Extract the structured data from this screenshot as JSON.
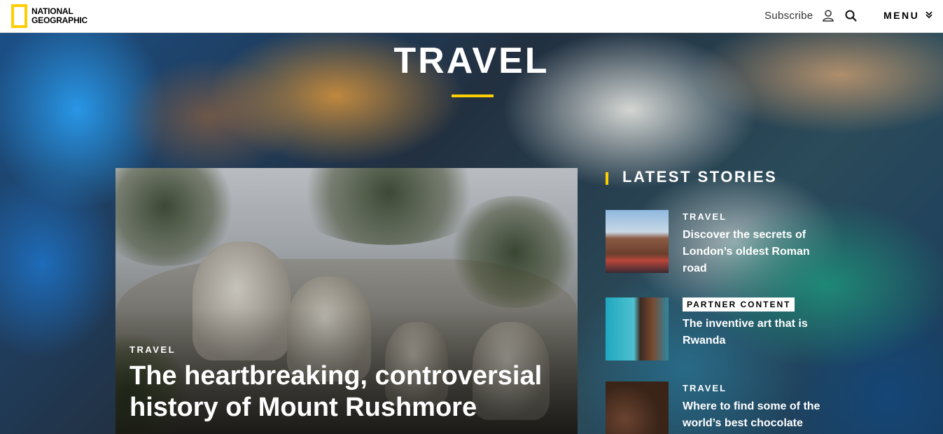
{
  "header": {
    "logo_line1": "NATIONAL",
    "logo_line2": "GEOGRAPHIC",
    "subscribe_label": "Subscribe",
    "menu_label": "MENU",
    "accent_color": "#ffce00"
  },
  "hero": {
    "title": "TRAVEL"
  },
  "feature": {
    "tag": "TRAVEL",
    "title": "The heartbreaking, controversial history of Mount Rushmore"
  },
  "latest": {
    "heading": "LATEST STORIES",
    "stories": [
      {
        "tag": "TRAVEL",
        "title": "Discover the secrets of London’s oldest Roman road"
      },
      {
        "tag": "PARTNER CONTENT",
        "title": "The inventive art that is Rwanda"
      },
      {
        "tag": "TRAVEL",
        "title": "Where to find some of the world’s best chocolate"
      }
    ]
  }
}
